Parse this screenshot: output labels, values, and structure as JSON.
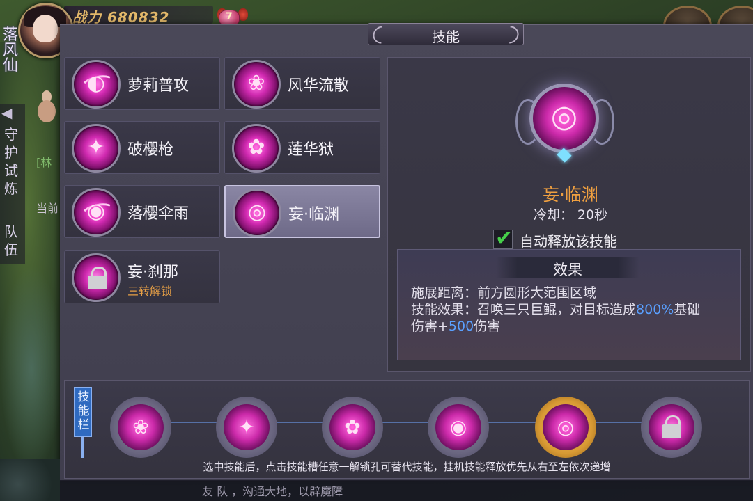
{
  "hud": {
    "player_name": "落风仙",
    "power_label": "战力",
    "power_value": "680832",
    "gem_count": "7"
  },
  "left": {
    "tab1": "守护试炼",
    "tab2": "队伍",
    "side_text_green": "[林",
    "side_text": "当前"
  },
  "panel": {
    "title": "技能"
  },
  "skills": [
    {
      "name": "萝莉普攻",
      "glyph": "◐",
      "locked": false
    },
    {
      "name": "风华流散",
      "glyph": "❀",
      "locked": false
    },
    {
      "name": "破樱枪",
      "glyph": "✦",
      "locked": false
    },
    {
      "name": "莲华狱",
      "glyph": "✿",
      "locked": false
    },
    {
      "name": "落樱伞雨",
      "glyph": "◉",
      "locked": false
    },
    {
      "name": "妄·临渊",
      "glyph": "◎",
      "locked": false,
      "selected": true
    },
    {
      "name": "妄·刹那",
      "sub": "三转解锁",
      "locked": true
    }
  ],
  "detail": {
    "name": "妄·临渊",
    "cooldown": "冷却： 20秒",
    "auto_checked": true,
    "auto_label": "自动释放该技能",
    "effect_title": "效果",
    "line1": "施展距离：前方圆形大范围区域",
    "line2_prefix": "技能效果：召唤三只巨鲲，对目标造成",
    "line2_pct": "800%",
    "line2_suffix": "基础",
    "line3_prefix": "伤害+",
    "line3_value": "500",
    "line3_suffix": "伤害",
    "highlight_color": "#5aa0ff"
  },
  "skillbar": {
    "tag": "技能栏",
    "slots": [
      {
        "glyph": "❀"
      },
      {
        "glyph": "✦"
      },
      {
        "glyph": "✿"
      },
      {
        "glyph": "◉"
      },
      {
        "glyph": "◎",
        "selected": true
      },
      {
        "glyph": "lock",
        "locked": true
      }
    ],
    "hint": "选中技能后，点击技能槽任意一解锁孔可替代技能，挂机技能释放优先从右至左依次递增"
  },
  "chat": {
    "text": "友   队   ，沟通大地，以辟魔障"
  }
}
